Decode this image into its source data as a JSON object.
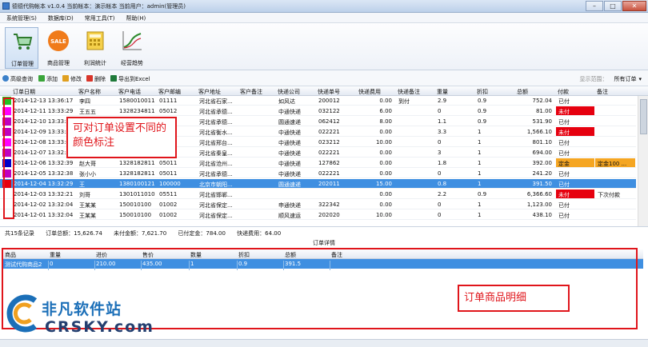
{
  "window": {
    "title": "德德代购帐本 v1.0.4  当前帐本：演示帐本   当前用户：admin(管理员)",
    "buttons": [
      "–",
      "□",
      "✕"
    ]
  },
  "menu": [
    "系统管理(S)",
    "数据库(D)",
    "常用工具(T)",
    "帮助(H)"
  ],
  "ribbon": [
    {
      "label": "订单管理",
      "icon": "cart-icon",
      "active": true
    },
    {
      "label": "商品管理",
      "icon": "sale-tag-icon",
      "active": false
    },
    {
      "label": "利润统计",
      "icon": "calculator-icon",
      "active": false
    },
    {
      "label": "经营趋势",
      "icon": "trend-chart-icon",
      "active": false
    }
  ],
  "toolbar": {
    "search": "高级查询",
    "add": "添加",
    "edit": "修改",
    "delete": "删除",
    "export": "导出到Excel",
    "range_label": "显示范围：",
    "range_value": "所有订单"
  },
  "orders": {
    "columns": [
      "订单日期",
      "客户名称",
      "客户电话",
      "客户邮编",
      "客户地址",
      "客户备注",
      "快递公司",
      "快递单号",
      "快递费用",
      "快递备注",
      "重量",
      "折扣",
      "总额",
      "付款",
      "备注"
    ],
    "rows": [
      {
        "marker": "#21c321",
        "date": "2014-12-13 13:36:17",
        "name": "李四",
        "phone": "1580010011",
        "zip": "01111",
        "addr": "河北省石家...",
        "cnote": "",
        "express": "如风达",
        "no": "200012",
        "fee": "0.00",
        "enote": "到付",
        "weight": "2.9",
        "disc": "0.9",
        "total": "752.04",
        "pay": "已付",
        "paycolor": "",
        "note": "",
        "notecolor": ""
      },
      {
        "marker": "#ff00ff",
        "date": "2014-12-11 13:33:29",
        "name": "王五五",
        "phone": "1328234811",
        "zip": "05012",
        "addr": "河北省承德...",
        "cnote": "",
        "express": "中通快递",
        "no": "032122",
        "fee": "6.00",
        "enote": "",
        "weight": "0",
        "disc": "0.9",
        "total": "81.00",
        "pay": "未付",
        "paycolor": "#e6000f",
        "note": "",
        "notecolor": ""
      },
      {
        "marker": "#c000c0",
        "date": "2014-12-10 13:33:29",
        "name": "",
        "phone": "",
        "zip": "",
        "addr": "河北省承德...",
        "cnote": "",
        "express": "圆通速递",
        "no": "062412",
        "fee": "8.00",
        "enote": "",
        "weight": "1.1",
        "disc": "0.9",
        "total": "531.90",
        "pay": "已付",
        "paycolor": "",
        "note": "",
        "notecolor": ""
      },
      {
        "marker": "#c000c0",
        "date": "2014-12-09 13:33:29",
        "name": "",
        "phone": "",
        "zip": "",
        "addr": "河北省衡水...",
        "cnote": "",
        "express": "中通快递",
        "no": "022221",
        "fee": "0.00",
        "enote": "",
        "weight": "3.3",
        "disc": "1",
        "total": "1,566.10",
        "pay": "未付",
        "paycolor": "#e6000f",
        "note": "",
        "notecolor": ""
      },
      {
        "marker": "#ff00ff",
        "date": "2014-12-08 13:33:05",
        "name": "",
        "phone": "",
        "zip": "",
        "addr": "河北省邢台...",
        "cnote": "",
        "express": "中通快递",
        "no": "023212",
        "fee": "10.00",
        "enote": "",
        "weight": "0",
        "disc": "1",
        "total": "801.10",
        "pay": "已付",
        "paycolor": "",
        "note": "",
        "notecolor": ""
      },
      {
        "marker": "#c000c0",
        "date": "2014-12-07 13:32:52",
        "name": "",
        "phone": "",
        "zip": "",
        "addr": "河北省秦皇...",
        "cnote": "",
        "express": "中通快递",
        "no": "022221",
        "fee": "0.00",
        "enote": "",
        "weight": "3",
        "disc": "1",
        "total": "694.00",
        "pay": "已付",
        "paycolor": "",
        "note": "",
        "notecolor": ""
      },
      {
        "marker": "#0000c8",
        "date": "2014-12-06 13:32:39",
        "name": "赵大哥",
        "phone": "1328182811",
        "zip": "05011",
        "addr": "河北省沧州...",
        "cnote": "",
        "express": "中通快递",
        "no": "127862",
        "fee": "0.00",
        "enote": "",
        "weight": "1.8",
        "disc": "1",
        "total": "392.00",
        "pay": "定金",
        "paycolor": "#f5a623",
        "note": "定金100 ...",
        "notecolor": "#f5a623"
      },
      {
        "marker": "#c000c0",
        "date": "2014-12-05 13:32:38",
        "name": "张小小",
        "phone": "1328182811",
        "zip": "05011",
        "addr": "河北省承德...",
        "cnote": "",
        "express": "中通快递",
        "no": "022221",
        "fee": "0.00",
        "enote": "",
        "weight": "0",
        "disc": "1",
        "total": "241.20",
        "pay": "已付",
        "paycolor": "",
        "note": "",
        "notecolor": ""
      },
      {
        "marker": "#e6000f",
        "date": "2014-12-04 13:32:29",
        "name": "王",
        "phone": "1380100121",
        "zip": "100000",
        "addr": "北京市朝阳...",
        "cnote": "",
        "express": "圆通速递",
        "no": "202011",
        "fee": "15.00",
        "enote": "",
        "weight": "0.8",
        "disc": "1",
        "total": "391.50",
        "pay": "已付",
        "paycolor": "",
        "note": "",
        "notecolor": "",
        "selected": true
      },
      {
        "marker": "#ffffff",
        "date": "2014-12-03 13:32:21",
        "name": "刘哥",
        "phone": "1301011010",
        "zip": "05511",
        "addr": "河北省邯郸...",
        "cnote": "",
        "express": "",
        "no": "",
        "fee": "0.00",
        "enote": "",
        "weight": "2.2",
        "disc": "0.9",
        "total": "6,366.60",
        "pay": "未付",
        "paycolor": "#e6000f",
        "note": "下次付款",
        "notecolor": ""
      },
      {
        "marker": "#ffffff",
        "date": "2014-12-02 13:32:04",
        "name": "王某某",
        "phone": "150010100",
        "zip": "01002",
        "addr": "河北省保定...",
        "cnote": "",
        "express": "申通快递",
        "no": "322342",
        "fee": "0.00",
        "enote": "",
        "weight": "0",
        "disc": "1",
        "total": "1,123.00",
        "pay": "已付",
        "paycolor": "",
        "note": "",
        "notecolor": ""
      },
      {
        "marker": "#ffffff",
        "date": "2014-12-01 13:32:04",
        "name": "王某某",
        "phone": "150010100",
        "zip": "01002",
        "addr": "河北省保定...",
        "cnote": "",
        "express": "顺风速运",
        "no": "202020",
        "fee": "10.00",
        "enote": "",
        "weight": "0",
        "disc": "1",
        "total": "438.10",
        "pay": "已付",
        "paycolor": "",
        "note": "",
        "notecolor": ""
      }
    ]
  },
  "summary": {
    "count": "共15条记录",
    "total": "订单总额：15,626.74",
    "unpaid": "未付金额：7,621.70",
    "deposit": "已付定金：784.00",
    "express": "快递费用：64.00"
  },
  "detail": {
    "title": "订单详情",
    "columns": [
      "商品",
      "重量",
      "进价",
      "售价",
      "数量",
      "折扣",
      "总额",
      "备注"
    ],
    "row": [
      "测试代购商品2",
      "0",
      "210.00",
      "435.00",
      "1",
      "0.9",
      "391.5",
      ""
    ]
  },
  "annotations": {
    "color_tip": "可对订单设置不同的颜色标注",
    "items_tip": "订单商品明细"
  },
  "watermark": {
    "line1": "非凡软件站",
    "line2": "CRSKY.com"
  }
}
